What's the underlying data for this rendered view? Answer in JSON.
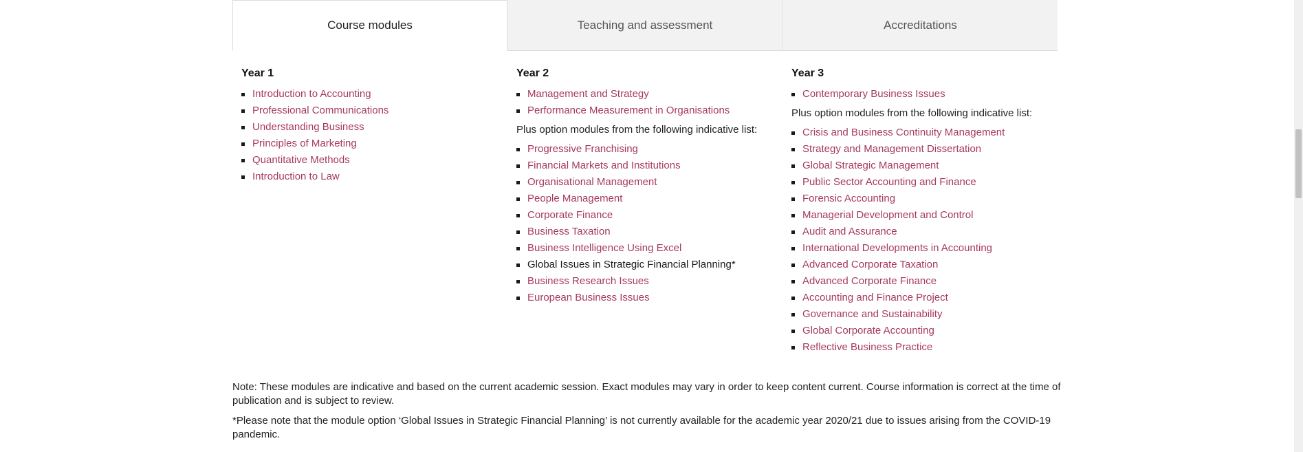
{
  "tabs": [
    {
      "label": "Course modules"
    },
    {
      "label": "Teaching and assessment"
    },
    {
      "label": "Accreditations"
    }
  ],
  "year1": {
    "title": "Year 1",
    "modules": [
      "Introduction to Accounting",
      "Professional Communications",
      "Understanding Business",
      "Principles of Marketing",
      "Quantitative Methods",
      "Introduction to Law"
    ]
  },
  "year2": {
    "title": "Year 2",
    "core": [
      "Management and Strategy",
      "Performance Measurement in Organisations"
    ],
    "plus_text": "Plus option modules from the following indicative list:",
    "options": [
      "Progressive Franchising",
      "Financial Markets and Institutions",
      "Organisational Management",
      "People Management",
      "Corporate Finance",
      "Business Taxation",
      "Business Intelligence Using Excel",
      "Global Issues in Strategic Financial Planning*",
      "Business Research Issues",
      "European Business Issues"
    ]
  },
  "year3": {
    "title": "Year 3",
    "core": [
      "Contemporary Business Issues"
    ],
    "plus_text": "Plus option modules from the following indicative list:",
    "options": [
      "Crisis and Business Continuity Management",
      "Strategy and Management Dissertation",
      "Global Strategic Management",
      "Public Sector Accounting and Finance",
      "Forensic Accounting",
      "Managerial Development and Control",
      "Audit and Assurance",
      "International Developments in Accounting",
      "Advanced Corporate Taxation",
      "Advanced Corporate Finance",
      "Accounting and Finance Project",
      "Governance and Sustainability",
      "Global Corporate Accounting",
      "Reflective Business Practice"
    ]
  },
  "notes": {
    "note1": "Note: These modules are indicative and based on the current academic session. Exact modules may vary in order to keep content current. Course information is correct at the time of publication and is subject to review.",
    "note2": "*Please note that the module option ‘Global Issues in Strategic Financial Planning’ is not currently available for the academic year 2020/21 due to issues arising from the COVID-19 pandemic."
  },
  "colors": {
    "link": "#a63a5b",
    "tab_inactive_bg": "#f2f2f2"
  }
}
